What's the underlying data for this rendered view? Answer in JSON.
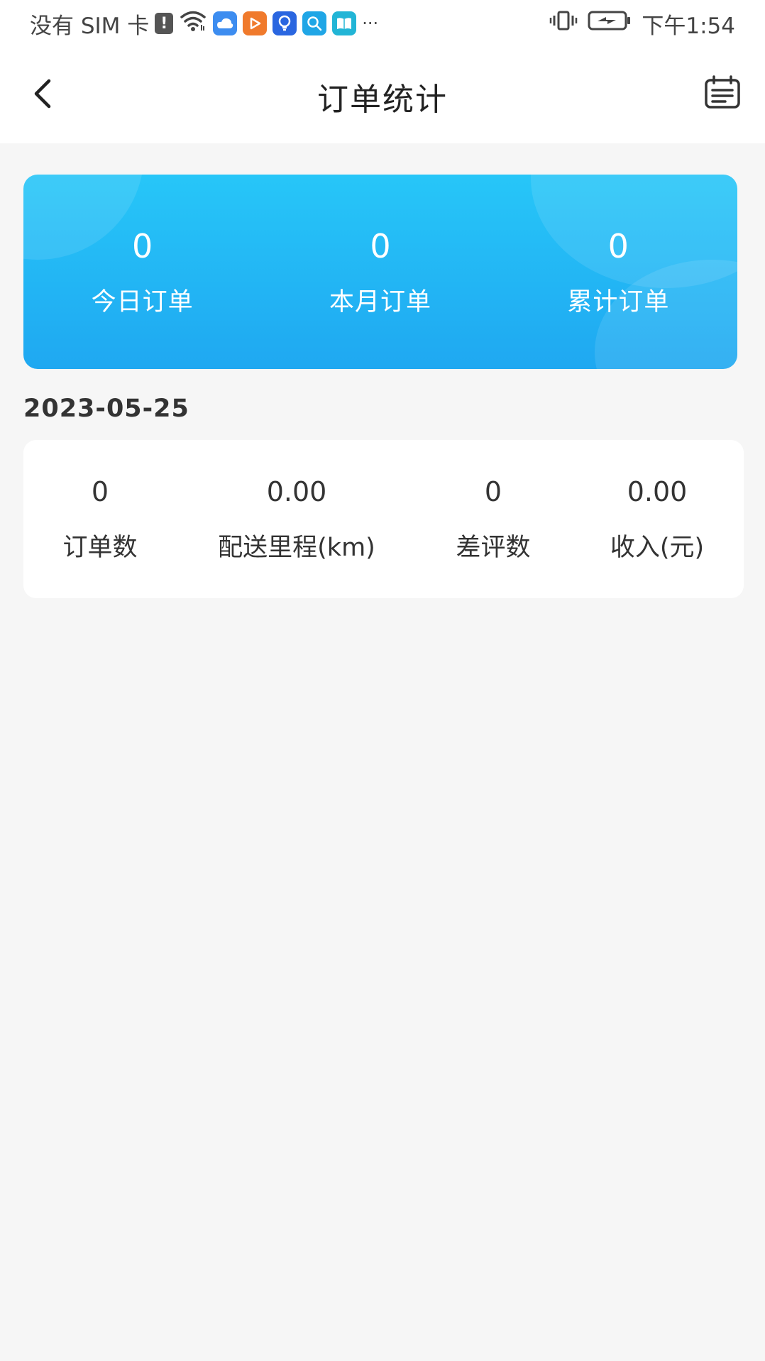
{
  "status_bar": {
    "carrier": "没有 SIM 卡",
    "alert_glyph": "!",
    "more": "···",
    "time": "下午1:54",
    "apps": [
      {
        "name": "cloud-app-icon",
        "color": "#3d8df0"
      },
      {
        "name": "video-app-icon",
        "color": "#f07a2c"
      },
      {
        "name": "bulb-app-icon",
        "color": "#2a66e0"
      },
      {
        "name": "search-app-icon",
        "color": "#20a6e6"
      },
      {
        "name": "book-app-icon",
        "color": "#22b5d6"
      }
    ]
  },
  "header": {
    "title": "订单统计",
    "back_icon": "chevron-left-icon",
    "calendar_icon": "calendar-icon"
  },
  "summary": {
    "items": [
      {
        "value": "0",
        "label": "今日订单"
      },
      {
        "value": "0",
        "label": "本月订单"
      },
      {
        "value": "0",
        "label": "累计订单"
      }
    ]
  },
  "daily": {
    "date": "2023-05-25",
    "stats": [
      {
        "value": "0",
        "label": "订单数"
      },
      {
        "value": "0.00",
        "label": "配送里程(km)"
      },
      {
        "value": "0",
        "label": "差评数"
      },
      {
        "value": "0.00",
        "label": "收入(元)"
      }
    ]
  },
  "colors": {
    "card_gradient_top": "#27c6f8",
    "card_gradient_bottom": "#1fa8f1",
    "page_background": "#f6f6f6"
  }
}
